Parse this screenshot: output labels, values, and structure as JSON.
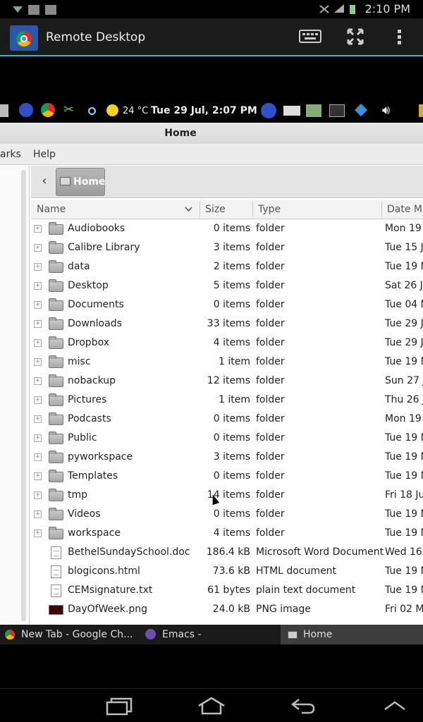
{
  "status_bar": {
    "time": "2:10 PM"
  },
  "app_bar": {
    "title": "Remote Desktop"
  },
  "panel": {
    "temperature": "24 °C",
    "clock": "Tue 29 Jul,  2:07 PM"
  },
  "window": {
    "title": "Home",
    "menu": {
      "bookmarks_partial": "arks",
      "help": "Help"
    },
    "breadcrumb": {
      "home": "Home"
    },
    "columns": {
      "name": "Name",
      "size": "Size",
      "type": "Type",
      "date": "Date M"
    },
    "rows": [
      {
        "name": "Audiobooks",
        "size": "0 items",
        "type": "folder",
        "date": "Mon 19",
        "kind": "folder"
      },
      {
        "name": "Calibre Library",
        "size": "3 items",
        "type": "folder",
        "date": "Tue 15 J",
        "kind": "folder"
      },
      {
        "name": "data",
        "size": "2 items",
        "type": "folder",
        "date": "Tue 19 N",
        "kind": "folder"
      },
      {
        "name": "Desktop",
        "size": "5 items",
        "type": "folder",
        "date": "Sat 26 J",
        "kind": "folder"
      },
      {
        "name": "Documents",
        "size": "0 items",
        "type": "folder",
        "date": "Tue 04 N",
        "kind": "folder"
      },
      {
        "name": "Downloads",
        "size": "33 items",
        "type": "folder",
        "date": "Tue 29 J",
        "kind": "folder"
      },
      {
        "name": "Dropbox",
        "size": "4 items",
        "type": "folder",
        "date": "Tue 29 J",
        "kind": "folder"
      },
      {
        "name": "misc",
        "size": "1 item",
        "type": "folder",
        "date": "Tue 19 N",
        "kind": "folder"
      },
      {
        "name": "nobackup",
        "size": "12 items",
        "type": "folder",
        "date": "Sun 27 J",
        "kind": "folder"
      },
      {
        "name": "Pictures",
        "size": "1 item",
        "type": "folder",
        "date": "Thu 26 J",
        "kind": "folder"
      },
      {
        "name": "Podcasts",
        "size": "0 items",
        "type": "folder",
        "date": "Mon 19",
        "kind": "folder"
      },
      {
        "name": "Public",
        "size": "0 items",
        "type": "folder",
        "date": "Tue 19 N",
        "kind": "folder"
      },
      {
        "name": "pyworkspace",
        "size": "3 items",
        "type": "folder",
        "date": "Tue 19 N",
        "kind": "folder"
      },
      {
        "name": "Templates",
        "size": "0 items",
        "type": "folder",
        "date": "Tue 19 N",
        "kind": "folder"
      },
      {
        "name": "tmp",
        "size": "14 items",
        "type": "folder",
        "date": "Fri 18 Ju",
        "kind": "folder"
      },
      {
        "name": "Videos",
        "size": "0 items",
        "type": "folder",
        "date": "Tue 19 N",
        "kind": "folder"
      },
      {
        "name": "workspace",
        "size": "4 items",
        "type": "folder",
        "date": "Tue 19 N",
        "kind": "folder"
      },
      {
        "name": "BethelSundaySchool.doc",
        "size": "186.4 kB",
        "type": "Microsoft Word Document",
        "date": "Wed 16",
        "kind": "doc"
      },
      {
        "name": "blogicons.html",
        "size": "73.6 kB",
        "type": "HTML document",
        "date": "Tue 19 N",
        "kind": "doc"
      },
      {
        "name": "CEMsignature.txt",
        "size": "61 bytes",
        "type": "plain text document",
        "date": "Tue 19 N",
        "kind": "doc"
      },
      {
        "name": "DayOfWeek.png",
        "size": "24.0 kB",
        "type": "PNG image",
        "date": "Fri 02 M",
        "kind": "image"
      }
    ]
  },
  "taskbar": {
    "tasks": [
      {
        "label": "New Tab - Google Ch..."
      },
      {
        "label": "Emacs -"
      },
      {
        "label": "Home"
      }
    ]
  },
  "colors": {
    "accent": "#33b5e5",
    "status_bg": "#000000",
    "window_bg": "#ffffff"
  }
}
